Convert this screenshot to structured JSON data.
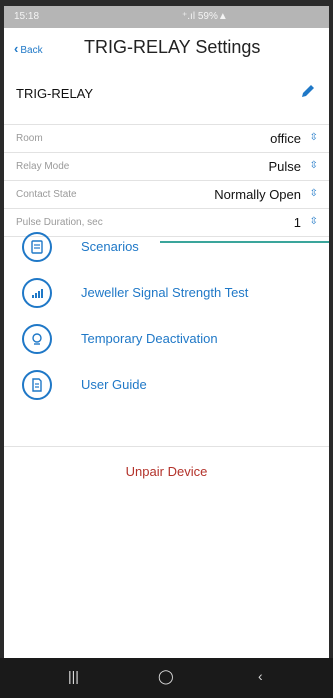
{
  "status_bar": {
    "time": "15:18",
    "icons": "⁺.ıl 59%▲"
  },
  "header": {
    "back_label": "Back",
    "title": "TRIG-RELAY Settings"
  },
  "device": {
    "name": "TRIG-RELAY"
  },
  "settings": [
    {
      "label": "Room",
      "value": "office"
    },
    {
      "label": "Relay Mode",
      "value": "Pulse"
    },
    {
      "label": "Contact State",
      "value": "Normally Open"
    },
    {
      "label": "Pulse Duration, sec",
      "value": "1"
    }
  ],
  "menu": [
    {
      "label": "Scenarios",
      "icon": "scenarios-icon"
    },
    {
      "label": "Jeweller Signal Strength Test",
      "icon": "signal-strength-icon"
    },
    {
      "label": "Temporary Deactivation",
      "icon": "deactivation-icon"
    },
    {
      "label": "User Guide",
      "icon": "user-guide-icon"
    }
  ],
  "unpair_label": "Unpair Device",
  "colors": {
    "accent": "#1f78c7",
    "danger": "#b3322a",
    "pointer": "#3aa59b"
  }
}
